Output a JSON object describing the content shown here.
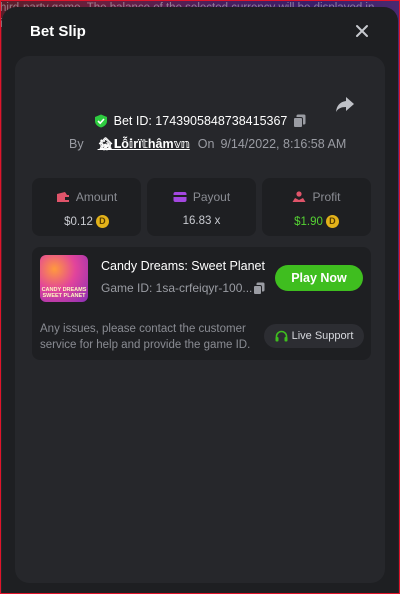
{
  "background": {
    "text_line1": "hird-party game. The balance of the selected currency will be displayed in",
    "text_line2": "ify"
  },
  "modal": {
    "title": "Bet Slip",
    "close_icon": "close-icon"
  },
  "bet": {
    "id_label": "Bet ID: 1743905848738415367",
    "by_label": "By",
    "username": "🏚ᒪỗ𝕚rï𝕥hâm𝕧𝕟",
    "on_label": "On",
    "datetime": "9/14/2022, 8:16:58 AM"
  },
  "stats": [
    {
      "label": "Amount",
      "value": "$0.12",
      "icon": "amount-icon",
      "color": "#e0546a",
      "coin": "D"
    },
    {
      "label": "Payout",
      "value": "16.83 x",
      "icon": "payout-icon",
      "color": "#a447e0"
    },
    {
      "label": "Profit",
      "value": "$1.90",
      "icon": "profit-icon",
      "color": "#e0546a",
      "value_color": "#55d233",
      "coin": "D"
    }
  ],
  "game": {
    "title": "Candy Dreams: Sweet Planet",
    "id_text": "Game ID: 1sa-crfeiqyr-100...",
    "thumb_line1": "CANDY DREAMS",
    "thumb_line2": "SWEET PLANET",
    "play_label": "Play Now",
    "issues_text": "Any issues, please contact the customer service for help and provide the game ID.",
    "support_label": "Live Support"
  },
  "colors": {
    "accent_green": "#3fbe1f",
    "shield_green": "#2ecc40",
    "coin_gold": "#e3b21a"
  }
}
